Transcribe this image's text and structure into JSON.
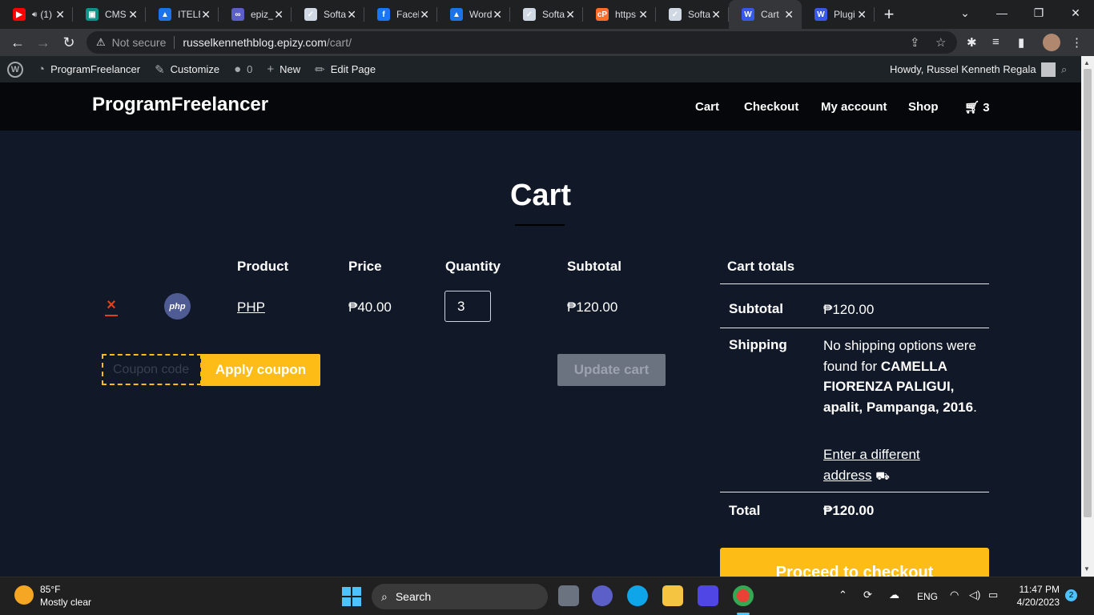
{
  "browser": {
    "tabs": [
      {
        "title": "(1)",
        "icon": "youtube-icon",
        "color": "#ff0000",
        "glyph": "▶",
        "audio": true
      },
      {
        "title": "CMS",
        "icon": "cms-icon",
        "color": "#0d9488",
        "glyph": "▣"
      },
      {
        "title": "ITELE",
        "icon": "google-drive-icon",
        "color": "#1a73e8",
        "glyph": "▲"
      },
      {
        "title": "epiz_",
        "icon": "infinity-icon",
        "color": "#5b5fc7",
        "glyph": "∞"
      },
      {
        "title": "Softa",
        "icon": "softaculous-icon",
        "color": "#cfd8e3",
        "glyph": "✓"
      },
      {
        "title": "Facel",
        "icon": "facebook-icon",
        "color": "#1877f2",
        "glyph": "f"
      },
      {
        "title": "Word",
        "icon": "google-drive-icon",
        "color": "#1a73e8",
        "glyph": "▲"
      },
      {
        "title": "Softa",
        "icon": "softaculous-icon",
        "color": "#cfd8e3",
        "glyph": "✓"
      },
      {
        "title": "https",
        "icon": "cpanel-icon",
        "color": "#ff6c2c",
        "glyph": "cP"
      },
      {
        "title": "Softa",
        "icon": "softaculous-icon",
        "color": "#cfd8e3",
        "glyph": "✓"
      },
      {
        "title": "Cart",
        "icon": "wordpress-icon",
        "color": "#3858e9",
        "glyph": "W",
        "active": true
      },
      {
        "title": "Plugi",
        "icon": "wordpress-icon",
        "color": "#3858e9",
        "glyph": "W"
      }
    ],
    "security_label": "Not secure",
    "url_host": "russelkennethblog.epizy.com",
    "url_path": "/cart/"
  },
  "admin_bar": {
    "site_name": "ProgramFreelancer",
    "customize": "Customize",
    "comments_count": "0",
    "new_label": "New",
    "edit_page": "Edit Page",
    "howdy": "Howdy, Russel Kenneth Regala"
  },
  "site": {
    "brand": "ProgramFreelancer",
    "nav": [
      "Cart",
      "Checkout",
      "My account",
      "Shop"
    ],
    "cart_count": "3"
  },
  "cart": {
    "title": "Cart",
    "headers": {
      "product": "Product",
      "price": "Price",
      "quantity": "Quantity",
      "subtotal": "Subtotal"
    },
    "item": {
      "name": "PHP",
      "thumb_label": "php",
      "price": "₱40.00",
      "quantity": "3",
      "subtotal": "₱120.00"
    },
    "coupon_placeholder": "Coupon code",
    "apply_coupon": "Apply coupon",
    "update_cart": "Update cart"
  },
  "totals": {
    "title": "Cart totals",
    "subtotal_label": "Subtotal",
    "subtotal_value": "₱120.00",
    "shipping_label": "Shipping",
    "shipping_text": "No shipping options were found for",
    "shipping_address": "CAMELLA FIORENZA PALIGUI, apalit, Pampanga, 2016",
    "shipping_link": "Enter a different address",
    "total_label": "Total",
    "total_value": "₱120.00",
    "checkout": "Proceed to checkout"
  },
  "taskbar": {
    "weather_temp": "85°F",
    "weather_desc": "Mostly clear",
    "search": "Search",
    "lang": "ENG",
    "time": "11:47 PM",
    "date": "4/20/2023",
    "notifications": "2"
  },
  "colors": {
    "accent": "#febd16",
    "page_bg": "#111827",
    "header_bg": "#06070a",
    "remove": "#e2401c"
  }
}
